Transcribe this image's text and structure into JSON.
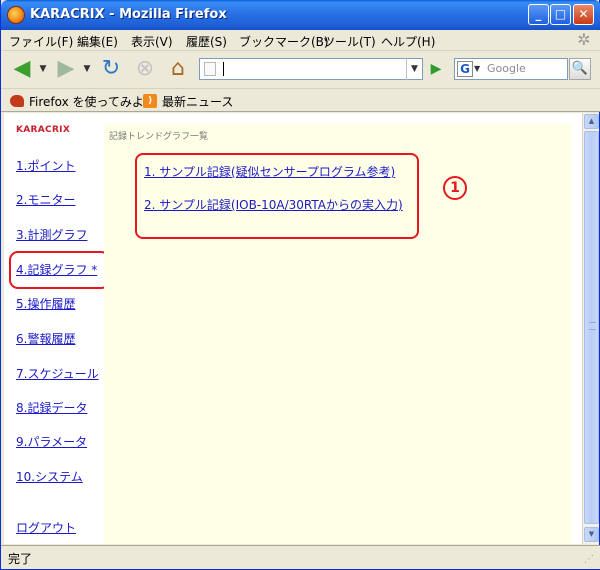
{
  "window": {
    "title": "KARACRIX - Mozilla Firefox"
  },
  "menu": {
    "items": [
      "ファイル(F)",
      "編集(E)",
      "表示(V)",
      "履歴(S)",
      "ブックマーク(B)",
      "ツール(T)",
      "ヘルプ(H)"
    ]
  },
  "toolbar": {
    "url_value": "",
    "search_placeholder": "Google",
    "search_engine_letter": "G"
  },
  "bookmarks": {
    "items": [
      "Firefox を使ってみよう",
      "最新ニュース"
    ]
  },
  "sidebar": {
    "brand": "KARACRIX",
    "items": [
      "1.ポイント",
      "2.モニター",
      "3.計測グラフ",
      "4.記録グラフ *",
      "5.操作履歴",
      "6.警報履歴",
      "7.スケジュール",
      "8.記録データ",
      "9.パラメータ",
      "10.システム"
    ],
    "logout": "ログアウト"
  },
  "main": {
    "title": "記録トレンドグラフ一覧",
    "links": [
      "1. サンプル記録(疑似センサープログラム参考)",
      "2. サンプル記録(IOB-10A/30RTAからの実入力)"
    ],
    "annotation": "1"
  },
  "status": {
    "text": "完了"
  },
  "colors": {
    "link": "#1a1ac8",
    "highlight": "#e8161e",
    "main_bg": "#ffffe8",
    "brand": "#c8202a"
  }
}
